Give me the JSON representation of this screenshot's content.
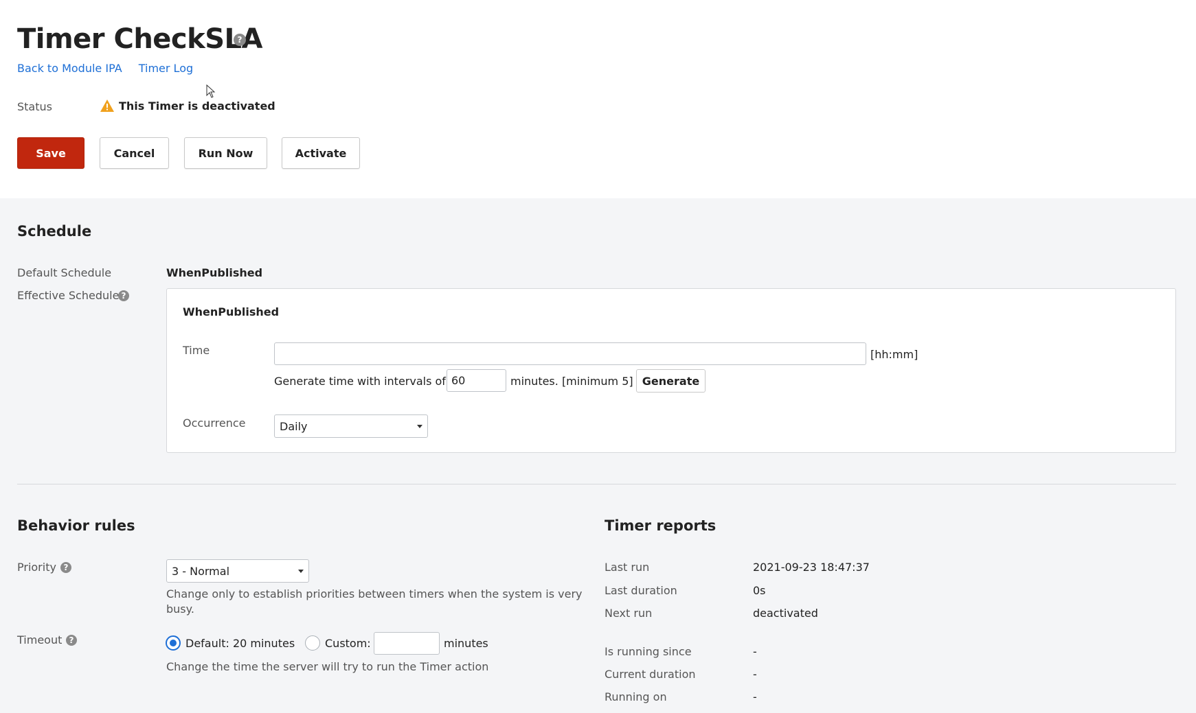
{
  "header": {
    "title": "Timer CheckSLA",
    "help_glyph": "?",
    "links": [
      "Back to Module IPA",
      "Timer Log"
    ],
    "status_label": "Status",
    "status_text": "This Timer is deactivated"
  },
  "actions": {
    "save": "Save",
    "cancel": "Cancel",
    "run_now": "Run Now",
    "activate": "Activate"
  },
  "schedule": {
    "title": "Schedule",
    "default_label": "Default Schedule",
    "default_value": "WhenPublished",
    "effective_label": "Effective Schedule",
    "box_title": "WhenPublished",
    "time_label": "Time",
    "time_value": "",
    "time_unit": "[hh:mm]",
    "interval_prefix": "Generate time with intervals of",
    "interval_value": "60",
    "interval_suffix": "minutes. [minimum 5]",
    "generate_label": "Generate",
    "occurrence_label": "Occurrence",
    "occurrence_value": "Daily"
  },
  "behavior": {
    "title": "Behavior rules",
    "priority_label": "Priority",
    "priority_value": "3 - Normal",
    "priority_hint_line1": "Change only to establish priorities between timers when the system is very",
    "priority_hint_line2": "busy.",
    "timeout_label": "Timeout",
    "timeout_default": "Default: 20 minutes",
    "timeout_custom": "Custom:",
    "timeout_custom_value": "",
    "timeout_unit": "minutes",
    "timeout_hint": "Change the time the server will try to run the Timer action"
  },
  "reports": {
    "title": "Timer reports",
    "rows": [
      {
        "label": "Last run",
        "value": "2021-09-23 18:47:37"
      },
      {
        "label": "Last duration",
        "value": "0s"
      },
      {
        "label": "Next run",
        "value": "deactivated"
      },
      {
        "label": "Is running since",
        "value": "-"
      },
      {
        "label": "Current duration",
        "value": "-"
      },
      {
        "label": "Running on",
        "value": "-"
      }
    ]
  },
  "colors": {
    "accent": "#1e6fd6",
    "primary_button": "#c1270e",
    "warning": "#f0a11e"
  }
}
